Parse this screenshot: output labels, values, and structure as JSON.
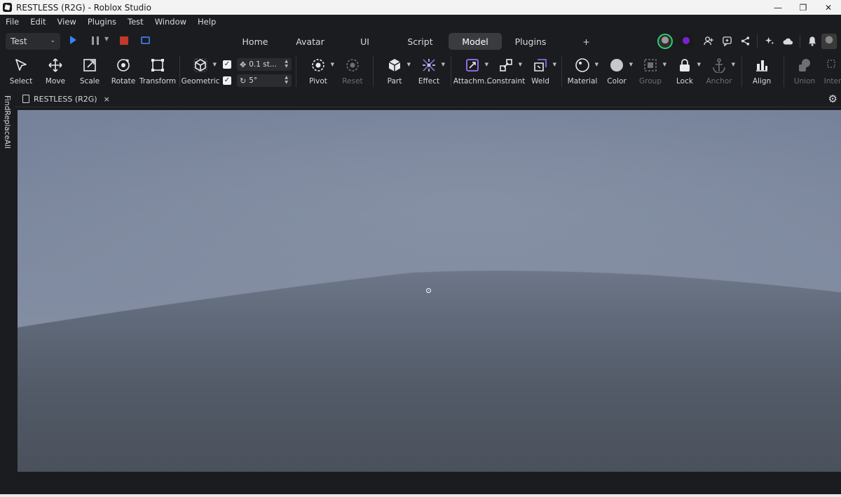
{
  "window": {
    "title": "RESTLESS (R2G) - Roblox Studio"
  },
  "menu": [
    "File",
    "Edit",
    "View",
    "Plugins",
    "Test",
    "Window",
    "Help"
  ],
  "nav": {
    "mode": "Test",
    "tabs": [
      "Home",
      "Avatar",
      "UI",
      "Script",
      "Model",
      "Plugins",
      "+"
    ],
    "active_tab": "Model"
  },
  "ribbon": {
    "select": "Select",
    "move": "Move",
    "scale": "Scale",
    "rotate": "Rotate",
    "transform": "Transform",
    "geometric": "Geometric",
    "move_snap": "0.1 st...",
    "rotate_snap": "5°",
    "pivot": "Pivot",
    "reset": "Reset",
    "part": "Part",
    "effect": "Effect",
    "attachment": "Attachm...",
    "constraint": "Constraint",
    "weld": "Weld",
    "material": "Material",
    "color": "Color",
    "group": "Group",
    "lock": "Lock",
    "anchor": "Anchor",
    "align": "Align",
    "union": "Union",
    "intersect": "Inter"
  },
  "side_panel": {
    "label": "FindReplaceAll"
  },
  "doc_tab": {
    "label": "RESTLESS (R2G)",
    "close": "×"
  },
  "colors": {
    "accent": "#3b82f6",
    "stop": "#c0392b",
    "active_tab": "#3a3b3f",
    "background": "#1b1c1f"
  }
}
